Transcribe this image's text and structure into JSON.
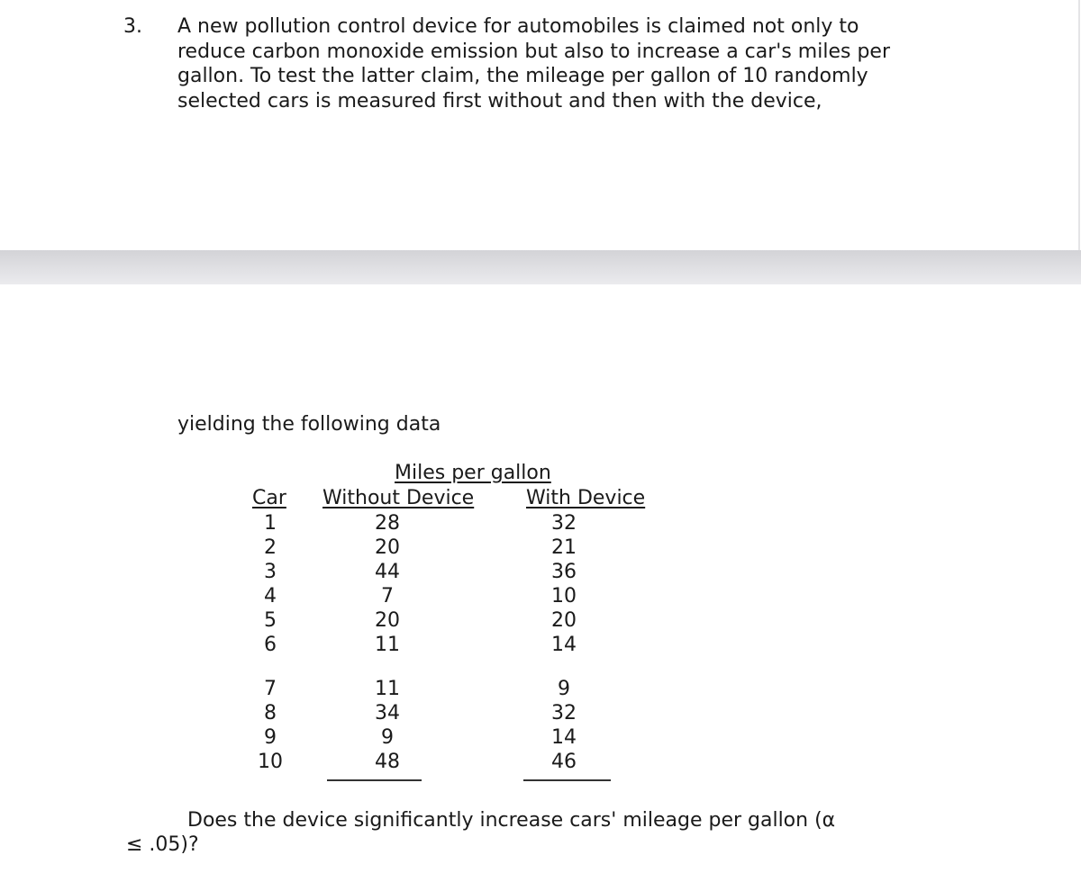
{
  "problem": {
    "number": "3.",
    "intro_lines": [
      "A new pollution control device for automobiles is claimed not only to",
      "reduce carbon monoxide emission but also to increase a car's miles per",
      "gallon.  To test the latter claim, the mileage per gallon of 10 randomly",
      "selected cars is measured first without and then with the device,"
    ],
    "continuation": "yielding the following data",
    "table": {
      "group_header": "Miles per gallon",
      "columns": [
        "Car",
        "Without Device",
        "With Device"
      ],
      "rows": [
        {
          "car": "1",
          "without": "28",
          "with": "32"
        },
        {
          "car": "2",
          "without": "20",
          "with": "21"
        },
        {
          "car": "3",
          "without": "44",
          "with": "36"
        },
        {
          "car": "4",
          "without": "7",
          "with": "10"
        },
        {
          "car": "5",
          "without": "20",
          "with": "20"
        },
        {
          "car": "6",
          "without": "11",
          "with": "14"
        },
        {
          "car": "7",
          "without": "11",
          "with": "9"
        },
        {
          "car": "8",
          "without": "34",
          "with": "32"
        },
        {
          "car": "9",
          "without": "9",
          "with": "14"
        },
        {
          "car": "10",
          "without": "48",
          "with": "46"
        }
      ]
    },
    "question_lines": [
      "Does the device significantly increase cars' mileage per gallon (α",
      "≤ .05)?"
    ]
  }
}
